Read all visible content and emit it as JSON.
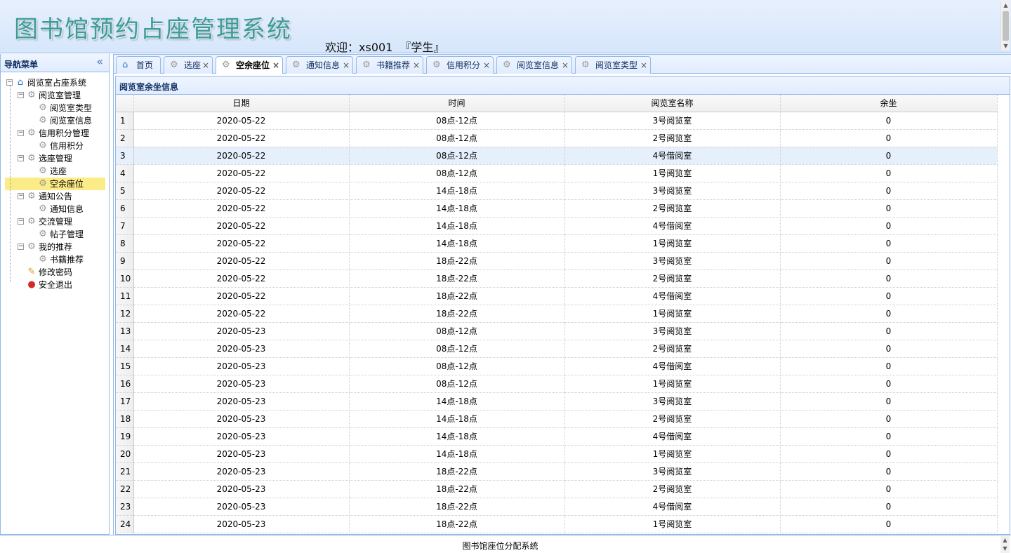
{
  "header": {
    "title": "图书馆预约占座管理系统",
    "welcome_label": "欢迎：",
    "username": "xs001",
    "role": "『学生』"
  },
  "sidebar": {
    "title": "导航菜单",
    "root": "阅览室占座系统",
    "groups": [
      {
        "label": "阅览室管理",
        "items": [
          "阅览室类型",
          "阅览室信息"
        ]
      },
      {
        "label": "信用积分管理",
        "items": [
          "信用积分"
        ]
      },
      {
        "label": "选座管理",
        "items": [
          "选座",
          "空余座位"
        ]
      },
      {
        "label": "通知公告",
        "items": [
          "通知信息"
        ]
      },
      {
        "label": "交流管理",
        "items": [
          "帖子管理"
        ]
      },
      {
        "label": "我的推荐",
        "items": [
          "书籍推荐"
        ]
      }
    ],
    "extra": [
      "修改密码",
      "安全退出"
    ],
    "selected": "空余座位"
  },
  "tabs": [
    {
      "label": "首页",
      "closable": false
    },
    {
      "label": "选座",
      "closable": true
    },
    {
      "label": "空余座位",
      "closable": true,
      "active": true
    },
    {
      "label": "通知信息",
      "closable": true
    },
    {
      "label": "书籍推荐",
      "closable": true
    },
    {
      "label": "信用积分",
      "closable": true
    },
    {
      "label": "阅览室信息",
      "closable": true
    },
    {
      "label": "阅览室类型",
      "closable": true
    }
  ],
  "panel": {
    "title": "阅览室余坐信息"
  },
  "table": {
    "columns": [
      "日期",
      "时间",
      "阅览室名称",
      "余坐"
    ],
    "rows": [
      [
        "2020-05-22",
        "08点-12点",
        "3号阅览室",
        "0"
      ],
      [
        "2020-05-22",
        "08点-12点",
        "2号阅览室",
        "0"
      ],
      [
        "2020-05-22",
        "08点-12点",
        "4号借阅室",
        "0"
      ],
      [
        "2020-05-22",
        "08点-12点",
        "1号阅览室",
        "0"
      ],
      [
        "2020-05-22",
        "14点-18点",
        "3号阅览室",
        "0"
      ],
      [
        "2020-05-22",
        "14点-18点",
        "2号阅览室",
        "0"
      ],
      [
        "2020-05-22",
        "14点-18点",
        "4号借阅室",
        "0"
      ],
      [
        "2020-05-22",
        "14点-18点",
        "1号阅览室",
        "0"
      ],
      [
        "2020-05-22",
        "18点-22点",
        "3号阅览室",
        "0"
      ],
      [
        "2020-05-22",
        "18点-22点",
        "2号阅览室",
        "0"
      ],
      [
        "2020-05-22",
        "18点-22点",
        "4号借阅室",
        "0"
      ],
      [
        "2020-05-22",
        "18点-22点",
        "1号阅览室",
        "0"
      ],
      [
        "2020-05-23",
        "08点-12点",
        "3号阅览室",
        "0"
      ],
      [
        "2020-05-23",
        "08点-12点",
        "2号阅览室",
        "0"
      ],
      [
        "2020-05-23",
        "08点-12点",
        "4号借阅室",
        "0"
      ],
      [
        "2020-05-23",
        "08点-12点",
        "1号阅览室",
        "0"
      ],
      [
        "2020-05-23",
        "14点-18点",
        "3号阅览室",
        "0"
      ],
      [
        "2020-05-23",
        "14点-18点",
        "2号阅览室",
        "0"
      ],
      [
        "2020-05-23",
        "14点-18点",
        "4号借阅室",
        "0"
      ],
      [
        "2020-05-23",
        "14点-18点",
        "1号阅览室",
        "0"
      ],
      [
        "2020-05-23",
        "18点-22点",
        "3号阅览室",
        "0"
      ],
      [
        "2020-05-23",
        "18点-22点",
        "2号阅览室",
        "0"
      ],
      [
        "2020-05-23",
        "18点-22点",
        "4号借阅室",
        "0"
      ],
      [
        "2020-05-23",
        "18点-22点",
        "1号阅览室",
        "0"
      ]
    ],
    "hover_row": 3
  },
  "footer": {
    "text": "图书馆座位分配系统"
  },
  "icons": {
    "home": "home-icon",
    "gear": "gear-icon",
    "password": "edit-password-icon",
    "logout": "logout-icon",
    "collapse": "double-chevron-left-icon"
  },
  "colors": {
    "border": "#95b8e7",
    "title": "#3f9b98",
    "selected": "#fbec88",
    "row_hover": "#e6effc"
  }
}
